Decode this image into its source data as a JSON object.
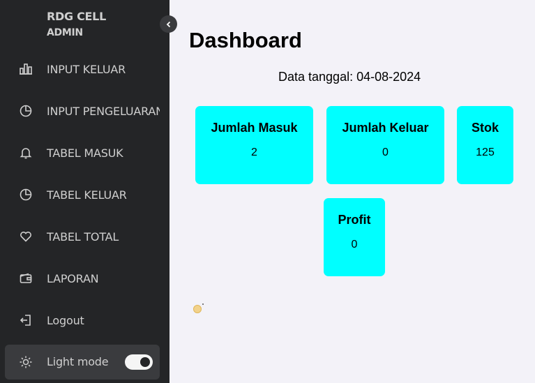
{
  "sidebar": {
    "brand_name": "RDG CELL",
    "brand_role": "ADMIN",
    "items": [
      {
        "label": "INPUT KELUAR",
        "icon": "bar-chart-icon"
      },
      {
        "label": "INPUT PENGELUARAN",
        "icon": "pie-chart-icon"
      },
      {
        "label": "TABEL MASUK",
        "icon": "bell-icon"
      },
      {
        "label": "TABEL KELUAR",
        "icon": "pie-chart-icon"
      },
      {
        "label": "TABEL TOTAL",
        "icon": "heart-icon"
      },
      {
        "label": "LAPORAN",
        "icon": "wallet-icon"
      },
      {
        "label": "Logout",
        "icon": "logout-icon"
      }
    ],
    "mode_label": "Light mode",
    "mode_icon": "sun-icon"
  },
  "main": {
    "title": "Dashboard",
    "date_line": "Data tanggal: 04-08-2024",
    "cards": [
      {
        "title": "Jumlah Masuk",
        "value": "2"
      },
      {
        "title": "Jumlah Keluar",
        "value": "0"
      },
      {
        "title": "Stok",
        "value": "125"
      },
      {
        "title": "Profit",
        "value": "0"
      }
    ]
  },
  "colors": {
    "sidebar_bg": "#242527",
    "main_bg": "#f3f2f8",
    "card_bg": "#00ffff"
  }
}
